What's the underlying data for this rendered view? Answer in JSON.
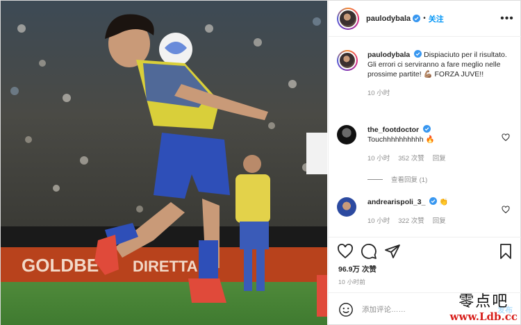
{
  "header": {
    "username": "paulodybala",
    "separator": "•",
    "follow_label": "关注",
    "more_label": "•••"
  },
  "caption": {
    "username": "paulodybala",
    "text": "Dispiaciuto per il risultato. Gli errori ci serviranno a fare meglio nelle prossime partite! 💪🏽 FORZA JUVE!!",
    "time": "10 小时"
  },
  "comments": [
    {
      "username": "the_footdoctor",
      "text": "Touchhhhhhhhhh 🔥",
      "time": "10 小时",
      "likes": "352 次赞",
      "reply": "回复"
    },
    {
      "username": "andrearispoli_3_",
      "text": "👏",
      "time": "10 小时",
      "likes": "322 次赞",
      "reply": "回复"
    }
  ],
  "view_replies": "查看回复 (1)",
  "actions": {
    "likes": "96.9万 次赞",
    "timestamp": "10 小时前"
  },
  "add_comment": {
    "placeholder": "添加评论……",
    "post_label": "发布"
  },
  "watermark": {
    "chinese": "零点吧",
    "url": "www.Ldb.cc"
  },
  "icons": {
    "like": "heart-icon",
    "comment": "comment-icon",
    "share": "send-icon",
    "save": "bookmark-icon",
    "emoji": "emoji-icon",
    "verified": "verified-badge-icon"
  },
  "colors": {
    "accent": "#0095f6",
    "verified": "#3897f0",
    "muted": "#8e8e8e",
    "watermark_red": "#d8201c"
  }
}
